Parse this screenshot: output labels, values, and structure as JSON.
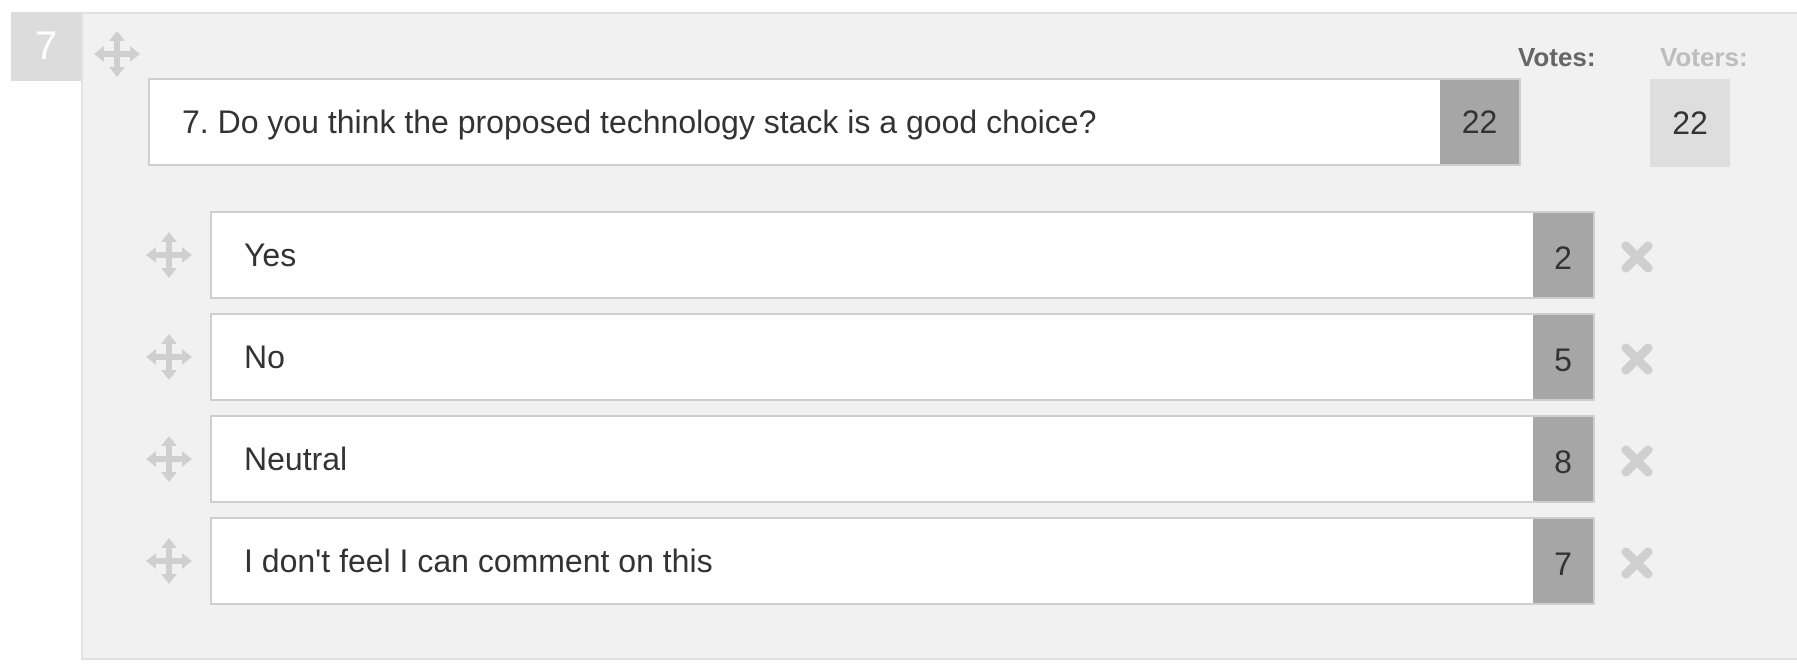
{
  "question": {
    "number": "7",
    "text": "7. Do you think the proposed technology stack is a good choice?",
    "votes": "22",
    "voters": "22"
  },
  "headers": {
    "votes_label": "Votes:",
    "voters_label": "Voters:"
  },
  "answers": [
    {
      "label": "Yes",
      "votes": "2"
    },
    {
      "label": "No",
      "votes": "5"
    },
    {
      "label": "Neutral",
      "votes": "8"
    },
    {
      "label": "I don't feel I can comment on this",
      "votes": "7"
    }
  ],
  "icons": {
    "drag_handle": "move-arrows-icon",
    "delete": "close-x-icon"
  },
  "colors": {
    "panel_bg": "#f1f1f1",
    "count_bg": "#a6a6a6",
    "voters_bg": "#dedede",
    "icon_gray": "#cfcfcf"
  }
}
